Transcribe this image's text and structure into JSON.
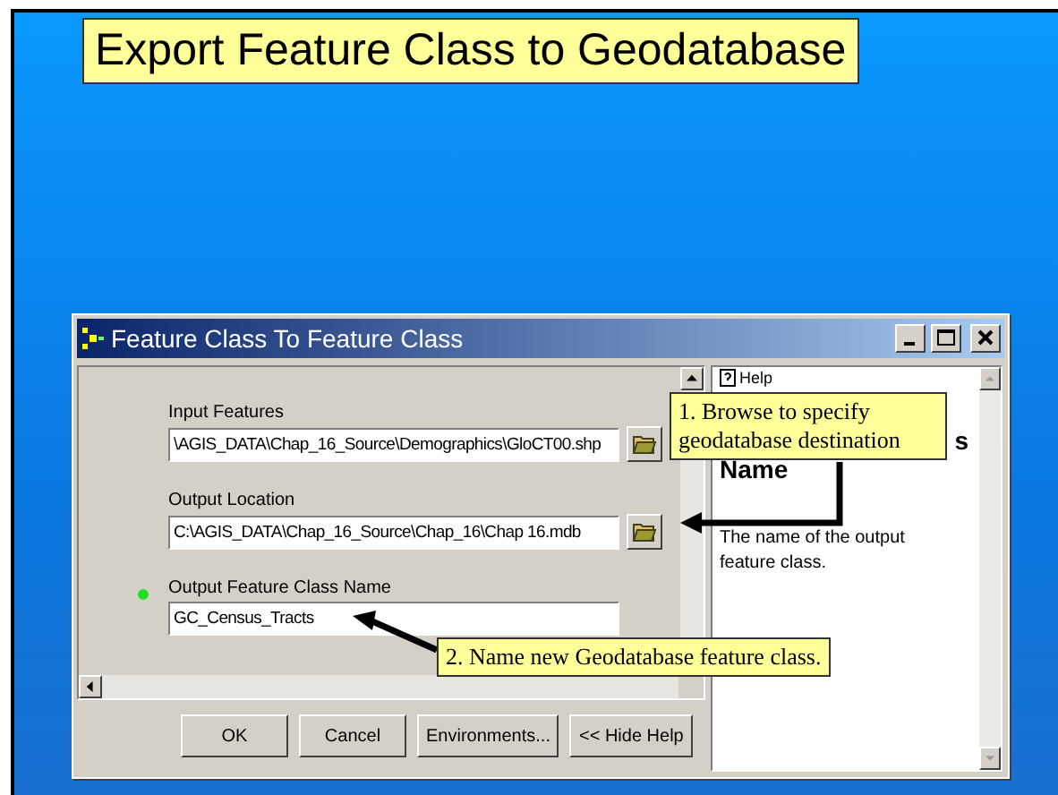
{
  "slide": {
    "title": "Export Feature Class to Geodatabase"
  },
  "window": {
    "title": "Feature Class To Feature Class"
  },
  "parameters": [
    {
      "label": "Input Features",
      "value": "\\AGIS_DATA\\Chap_16_Source\\Demographics\\GloCT00.shp",
      "required": false,
      "browse": true
    },
    {
      "label": "Output Location",
      "value": "C:\\AGIS_DATA\\Chap_16_Source\\Chap_16\\Chap 16.mdb",
      "required": false,
      "browse": true
    },
    {
      "label": "Output Feature Class Name",
      "value": "GC_Census_Tracts",
      "required": true,
      "browse": false
    }
  ],
  "buttons": [
    "OK",
    "Cancel",
    "Environments...",
    "<< Hide Help"
  ],
  "help": {
    "tab": "Help",
    "heading": [
      "s",
      "Name"
    ],
    "text": "The name of the output feature class."
  },
  "callouts": [
    {
      "text": "1. Browse to specify geodatabase destination"
    },
    {
      "text": "2. Name new Geodatabase feature class."
    }
  ]
}
